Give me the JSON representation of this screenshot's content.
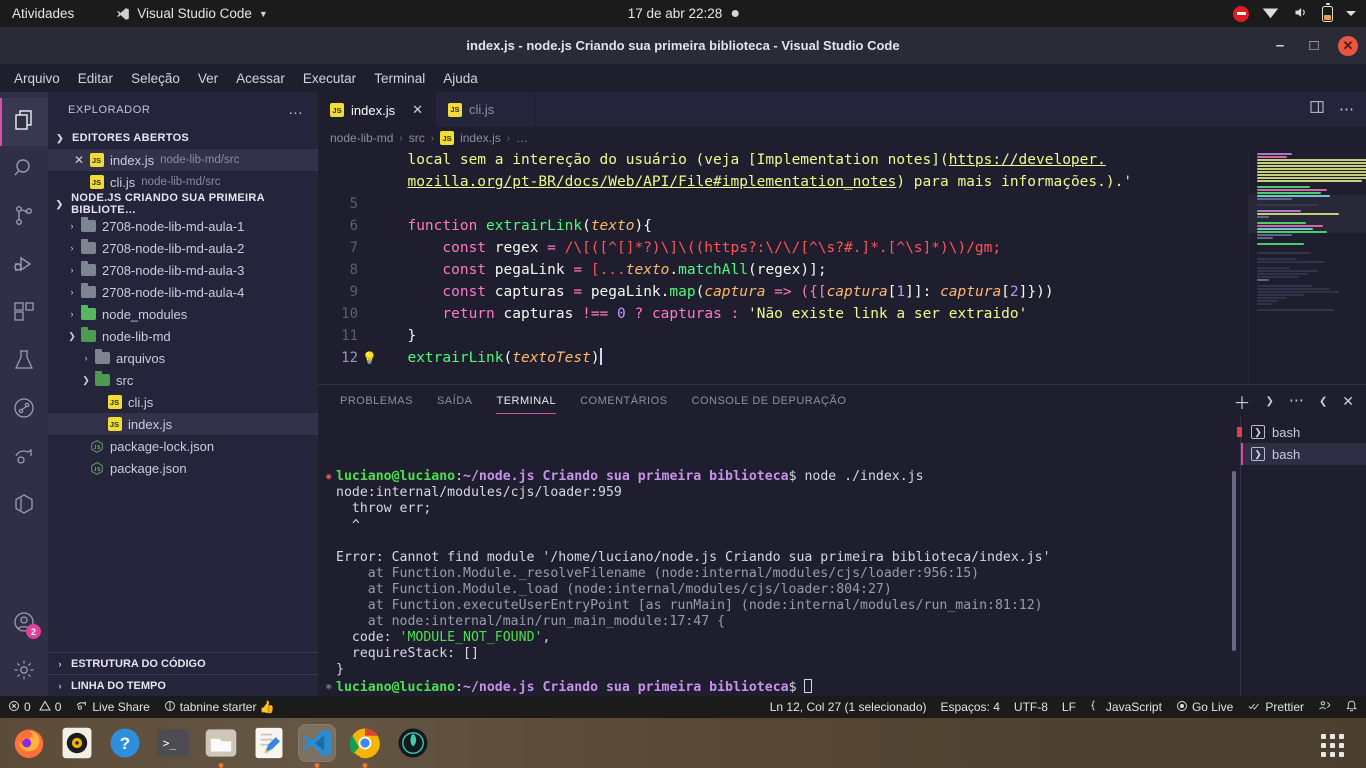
{
  "gnome": {
    "activities": "Atividades",
    "app_name": "Visual Studio Code",
    "clock": "17 de abr  22:28",
    "icons": [
      "do-not-disturb-icon",
      "wifi-icon",
      "volume-icon",
      "battery-icon",
      "chevron-down-icon"
    ]
  },
  "window": {
    "title": "index.js - node.js Criando sua primeira biblioteca - Visual Studio Code",
    "minimize": "–",
    "maximize": "□",
    "close": "✕"
  },
  "menu": [
    "Arquivo",
    "Editar",
    "Seleção",
    "Ver",
    "Acessar",
    "Executar",
    "Terminal",
    "Ajuda"
  ],
  "activity_bar": [
    {
      "name": "explorer",
      "icon": "files-icon",
      "active": true,
      "badge": null
    },
    {
      "name": "search",
      "icon": "search-icon",
      "active": false,
      "badge": null
    },
    {
      "name": "source-control",
      "icon": "source-control-icon",
      "active": false,
      "badge": null
    },
    {
      "name": "run-debug",
      "icon": "run-and-debug-icon",
      "active": false,
      "badge": null
    },
    {
      "name": "extensions",
      "icon": "extensions-icon",
      "active": false,
      "badge": null
    },
    {
      "name": "testing",
      "icon": "beaker-icon",
      "active": false,
      "badge": null
    },
    {
      "name": "graph",
      "icon": "circle-graph-icon",
      "active": false,
      "badge": null
    },
    {
      "name": "live-share",
      "icon": "live-share-icon",
      "active": false,
      "badge": null
    },
    {
      "name": "docker",
      "icon": "cube-icon",
      "active": false,
      "badge": null
    }
  ],
  "activity_bar_bottom": [
    {
      "name": "accounts",
      "icon": "account-icon",
      "badge": "2"
    },
    {
      "name": "settings",
      "icon": "gear-icon",
      "badge": null
    }
  ],
  "sidebar": {
    "header": "EXPLORADOR",
    "more": "…",
    "open_editors": {
      "title": "EDITORES ABERTOS",
      "items": [
        {
          "name": "index.js",
          "path": "node-lib-md/src",
          "selected": true,
          "has_close": true,
          "icon": "js-file-icon"
        },
        {
          "name": "cli.js",
          "path": "node-lib-md/src",
          "selected": false,
          "has_close": false,
          "icon": "js-file-icon"
        }
      ]
    },
    "project": {
      "title": "NODE.JS CRIANDO SUA PRIMEIRA BIBLIOTE…",
      "items": [
        {
          "label": "2708-node-lib-md-aula-1",
          "type": "folder",
          "depth": 1,
          "expanded": false,
          "selected": false
        },
        {
          "label": "2708-node-lib-md-aula-2",
          "type": "folder",
          "depth": 1,
          "expanded": false,
          "selected": false
        },
        {
          "label": "2708-node-lib-md-aula-3",
          "type": "folder",
          "depth": 1,
          "expanded": false,
          "selected": false
        },
        {
          "label": "2708-node-lib-md-aula-4",
          "type": "folder",
          "depth": 1,
          "expanded": false,
          "selected": false
        },
        {
          "label": "node_modules",
          "type": "folder-green",
          "depth": 1,
          "expanded": false,
          "selected": false
        },
        {
          "label": "node-lib-md",
          "type": "folder-open",
          "depth": 1,
          "expanded": true,
          "selected": false
        },
        {
          "label": "arquivos",
          "type": "folder",
          "depth": 2,
          "expanded": false,
          "selected": false
        },
        {
          "label": "src",
          "type": "folder-open-code",
          "depth": 2,
          "expanded": true,
          "selected": false
        },
        {
          "label": "cli.js",
          "type": "js",
          "depth": 3,
          "expanded": null,
          "selected": false
        },
        {
          "label": "index.js",
          "type": "js",
          "depth": 3,
          "expanded": null,
          "selected": true
        },
        {
          "label": "package-lock.json",
          "type": "node",
          "depth": 2,
          "expanded": null,
          "selected": false
        },
        {
          "label": "package.json",
          "type": "node",
          "depth": 2,
          "expanded": null,
          "selected": false
        }
      ]
    },
    "collapsed_sections": [
      "ESTRUTURA DO CÓDIGO",
      "LINHA DO TEMPO"
    ]
  },
  "editor": {
    "tabs": [
      {
        "label": "index.js",
        "active": true,
        "icon": "js-file-icon",
        "closable": true
      },
      {
        "label": "cli.js",
        "active": false,
        "icon": "js-file-icon",
        "closable": false
      }
    ],
    "tab_actions": [
      "split-editor-icon",
      "more-actions-icon"
    ],
    "breadcrumb": [
      "node-lib-md",
      "src",
      "index.js",
      "…"
    ],
    "lines": [
      {
        "no": "",
        "segments": [
          {
            "t": "  local sem a intereção do usuário (veja [Implementation notes](",
            "c": "str"
          },
          {
            "t": "https://developer.",
            "c": "link"
          }
        ]
      },
      {
        "no": "",
        "segments": [
          {
            "t": "  ",
            "c": "str"
          },
          {
            "t": "mozilla.org/pt-BR/docs/Web/API/File#implementation_notes",
            "c": "link"
          },
          {
            "t": ") para mais informações.).'",
            "c": "str"
          }
        ]
      },
      {
        "no": "5",
        "segments": []
      },
      {
        "no": "6",
        "segments": [
          {
            "t": "  ",
            "c": "pl"
          },
          {
            "t": "function",
            "c": "k"
          },
          {
            "t": " ",
            "c": "pl"
          },
          {
            "t": "extrairLink",
            "c": "fn"
          },
          {
            "t": "(",
            "c": "pl"
          },
          {
            "t": "texto",
            "c": "par"
          },
          {
            "t": "){",
            "c": "pl"
          }
        ]
      },
      {
        "no": "7",
        "segments": [
          {
            "t": "      ",
            "c": "pl"
          },
          {
            "t": "const",
            "c": "k"
          },
          {
            "t": " regex ",
            "c": "pl"
          },
          {
            "t": "=",
            "c": "op"
          },
          {
            "t": " /\\[([^[]*?)\\]\\((https?:\\/\\/[^\\s?#.]*.[^\\s]*)\\)/gm;",
            "c": "rx"
          }
        ]
      },
      {
        "no": "8",
        "segments": [
          {
            "t": "      ",
            "c": "pl"
          },
          {
            "t": "const",
            "c": "k"
          },
          {
            "t": " pegaLink ",
            "c": "pl"
          },
          {
            "t": "=",
            "c": "op"
          },
          {
            "t": " [...",
            "c": "rx"
          },
          {
            "t": "texto",
            "c": "par"
          },
          {
            "t": ".",
            "c": "pl"
          },
          {
            "t": "matchAll",
            "c": "fn"
          },
          {
            "t": "(regex)];",
            "c": "pl"
          }
        ]
      },
      {
        "no": "9",
        "segments": [
          {
            "t": "      ",
            "c": "pl"
          },
          {
            "t": "const",
            "c": "k"
          },
          {
            "t": " capturas ",
            "c": "pl"
          },
          {
            "t": "=",
            "c": "op"
          },
          {
            "t": " pegaLink.",
            "c": "pl"
          },
          {
            "t": "map",
            "c": "fn"
          },
          {
            "t": "(",
            "c": "pl"
          },
          {
            "t": "captura",
            "c": "par"
          },
          {
            "t": " => ({[",
            "c": "op"
          },
          {
            "t": "captura",
            "c": "par"
          },
          {
            "t": "[",
            "c": "pl"
          },
          {
            "t": "1",
            "c": "num"
          },
          {
            "t": "]]: ",
            "c": "pl"
          },
          {
            "t": "captura",
            "c": "par"
          },
          {
            "t": "[",
            "c": "pl"
          },
          {
            "t": "2",
            "c": "num"
          },
          {
            "t": "]}))",
            "c": "pl"
          }
        ]
      },
      {
        "no": "10",
        "segments": [
          {
            "t": "      ",
            "c": "pl"
          },
          {
            "t": "return",
            "c": "k"
          },
          {
            "t": " capturas ",
            "c": "pl"
          },
          {
            "t": "!==",
            "c": "op"
          },
          {
            "t": " ",
            "c": "pl"
          },
          {
            "t": "0",
            "c": "num"
          },
          {
            "t": " ? capturas : ",
            "c": "op"
          },
          {
            "t": "'Não existe link a ser extraido'",
            "c": "str"
          }
        ]
      },
      {
        "no": "11",
        "segments": [
          {
            "t": "  }",
            "c": "pl"
          }
        ]
      },
      {
        "no": "12",
        "bulb": true,
        "segments": [
          {
            "t": "  ",
            "c": "pl"
          },
          {
            "t": "extrairLink",
            "c": "fn"
          },
          {
            "t": "(",
            "c": "pl"
          },
          {
            "t": "textoTest",
            "c": "par"
          },
          {
            "t": ")",
            "c": "pl"
          }
        ]
      }
    ]
  },
  "panel": {
    "tabs": [
      "PROBLEMAS",
      "SAÍDA",
      "TERMINAL",
      "COMENTÁRIOS",
      "CONSOLE DE DEPURAÇÃO"
    ],
    "active_tab": "TERMINAL",
    "actions": [
      "new-terminal-icon",
      "chevron-down-icon",
      "more-actions-icon",
      "maximize-panel-icon",
      "close-panel-icon"
    ],
    "terminal_list": [
      {
        "label": "bash",
        "selected": false,
        "error": true
      },
      {
        "label": "bash",
        "selected": true,
        "error": false
      }
    ],
    "terminal_lines": [
      {
        "marker": "error",
        "segments": [
          {
            "t": "luciano@luciano",
            "c": "t-user"
          },
          {
            "t": ":",
            "c": "t-white"
          },
          {
            "t": "~/node.js Criando sua primeira biblioteca",
            "c": "t-path"
          },
          {
            "t": "$ node ./index.js",
            "c": "t-white"
          }
        ]
      },
      {
        "marker": "",
        "segments": [
          {
            "t": "node:internal/modules/cjs/loader:959",
            "c": "t-white"
          }
        ]
      },
      {
        "marker": "",
        "segments": [
          {
            "t": "  throw err;",
            "c": "t-white"
          }
        ]
      },
      {
        "marker": "",
        "segments": [
          {
            "t": "  ^",
            "c": "t-white"
          }
        ]
      },
      {
        "marker": "",
        "segments": [
          {
            "t": "",
            "c": "t-white"
          }
        ]
      },
      {
        "marker": "",
        "segments": [
          {
            "t": "Error: Cannot find module '/home/luciano/node.js Criando sua primeira biblioteca/index.js'",
            "c": "t-white"
          }
        ]
      },
      {
        "marker": "",
        "segments": [
          {
            "t": "    at Function.Module._resolveFilename (node:internal/modules/cjs/loader:956:15)",
            "c": "t-gray"
          }
        ]
      },
      {
        "marker": "",
        "segments": [
          {
            "t": "    at Function.Module._load (node:internal/modules/cjs/loader:804:27)",
            "c": "t-gray"
          }
        ]
      },
      {
        "marker": "",
        "segments": [
          {
            "t": "    at Function.executeUserEntryPoint [as runMain] (node:internal/modules/run_main:81:12)",
            "c": "t-gray"
          }
        ]
      },
      {
        "marker": "",
        "segments": [
          {
            "t": "    at node:internal/main/run_main_module:17:47 {",
            "c": "t-gray"
          }
        ]
      },
      {
        "marker": "",
        "segments": [
          {
            "t": "  code: ",
            "c": "t-white"
          },
          {
            "t": "'MODULE_NOT_FOUND'",
            "c": "t-green"
          },
          {
            "t": ",",
            "c": "t-white"
          }
        ]
      },
      {
        "marker": "",
        "segments": [
          {
            "t": "  requireStack: []",
            "c": "t-white"
          }
        ]
      },
      {
        "marker": "",
        "segments": [
          {
            "t": "}",
            "c": "t-white"
          }
        ]
      },
      {
        "marker": "ok",
        "segments": [
          {
            "t": "luciano@luciano",
            "c": "t-user"
          },
          {
            "t": ":",
            "c": "t-white"
          },
          {
            "t": "~/node.js Criando sua primeira biblioteca",
            "c": "t-path"
          },
          {
            "t": "$ ",
            "c": "t-white"
          }
        ],
        "cursor": true
      }
    ]
  },
  "status_bar": {
    "left": [
      {
        "name": "problems",
        "icon": "error-icon",
        "text": "0",
        "icon2": "warning-icon",
        "text2": "0"
      },
      {
        "name": "live-share",
        "icon": "live-share-icon",
        "text": "Live Share"
      },
      {
        "name": "tabnine",
        "icon": "tabnine-icon",
        "text": "tabnine starter 👍"
      }
    ],
    "right": [
      {
        "name": "cursor-position",
        "text": "Ln 12, Col 27 (1 selecionado)"
      },
      {
        "name": "indentation",
        "text": "Espaços: 4"
      },
      {
        "name": "encoding",
        "text": "UTF-8"
      },
      {
        "name": "eol",
        "text": "LF"
      },
      {
        "name": "language-mode",
        "text": "JavaScript",
        "icon": "braces-icon"
      },
      {
        "name": "go-live",
        "text": "Go Live",
        "icon": "broadcast-icon"
      },
      {
        "name": "prettier",
        "text": "Prettier",
        "icon": "check-check-icon"
      },
      {
        "name": "feedback",
        "text": "",
        "icon": "feedback-icon"
      },
      {
        "name": "notifications",
        "text": "",
        "icon": "bell-icon"
      }
    ]
  },
  "dock": {
    "items": [
      {
        "name": "firefox",
        "icon": "firefox-icon",
        "running": false,
        "focused": false
      },
      {
        "name": "rhythmbox",
        "icon": "rhythmbox-icon",
        "running": false,
        "focused": false
      },
      {
        "name": "help",
        "icon": "help-icon",
        "running": false,
        "focused": false
      },
      {
        "name": "terminal",
        "icon": "terminal-icon",
        "running": false,
        "focused": false
      },
      {
        "name": "files",
        "icon": "files-icon",
        "running": true,
        "focused": false
      },
      {
        "name": "text-editor",
        "icon": "text-editor-icon",
        "running": false,
        "focused": false
      },
      {
        "name": "visual-studio-code",
        "icon": "vscode-icon",
        "running": true,
        "focused": true
      },
      {
        "name": "google-chrome",
        "icon": "chrome-icon",
        "running": true,
        "focused": false
      },
      {
        "name": "insomnia",
        "icon": "insomnia-icon",
        "running": false,
        "focused": false
      }
    ],
    "show_apps": "show-applications-icon"
  },
  "colors": {
    "accent": "#d84fa8",
    "editor_bg": "#1e1e2e",
    "sidebar_bg": "#24243a",
    "activity_bg": "#302f45",
    "titlebar_bg": "#2b2b38"
  }
}
